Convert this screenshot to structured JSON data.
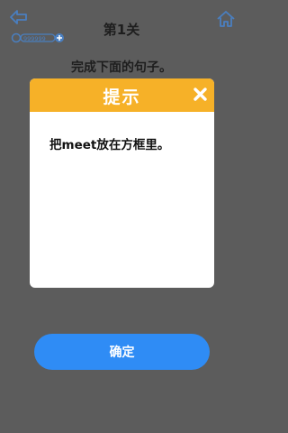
{
  "header": {
    "level_title": "第1关",
    "back_icon": "back-arrow-icon",
    "home_icon": "home-icon",
    "coin_icon": "coin-meter-icon"
  },
  "instruction": "完成下面的句子。",
  "dialog": {
    "title": "提示",
    "message": "把meet放在方框里。",
    "close_icon": "close-icon"
  },
  "confirm_label": "确定",
  "colors": {
    "background": "#5c5c5c",
    "dialog_header": "#f6b128",
    "button": "#2f8cf5",
    "icon": "#4a7fc0"
  }
}
